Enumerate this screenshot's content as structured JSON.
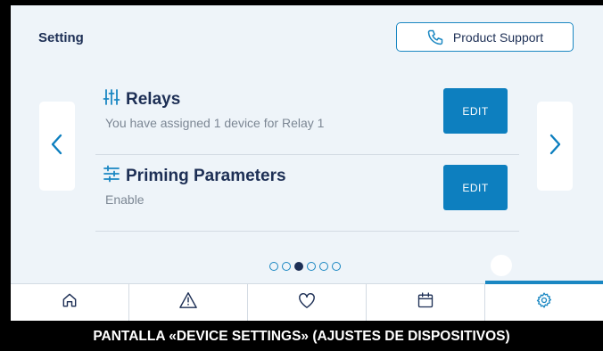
{
  "header": {
    "title": "Setting",
    "support_label": "Product Support"
  },
  "rows": [
    {
      "title": "Relays",
      "subtitle": "You have assigned 1 device for Relay 1",
      "edit_label": "EDIT",
      "icon": "sliders-vertical-icon"
    },
    {
      "title": "Priming Parameters",
      "subtitle": "Enable",
      "edit_label": "EDIT",
      "icon": "sliders-horizontal-icon"
    }
  ],
  "pagination": {
    "total": 6,
    "current": 3
  },
  "tabs": [
    {
      "icon": "home-icon",
      "active": false
    },
    {
      "icon": "warning-icon",
      "active": false
    },
    {
      "icon": "heart-icon",
      "active": false
    },
    {
      "icon": "calendar-icon",
      "active": false
    },
    {
      "icon": "settings-gear-icon",
      "active": true
    }
  ],
  "colors": {
    "accent": "#1a87c2",
    "button": "#0d7fbf",
    "title": "#1d2f55",
    "background": "#eef4f9"
  },
  "caption": "PANTALLA «DEVICE SETTINGS» (AJUSTES DE DISPOSITIVOS)"
}
